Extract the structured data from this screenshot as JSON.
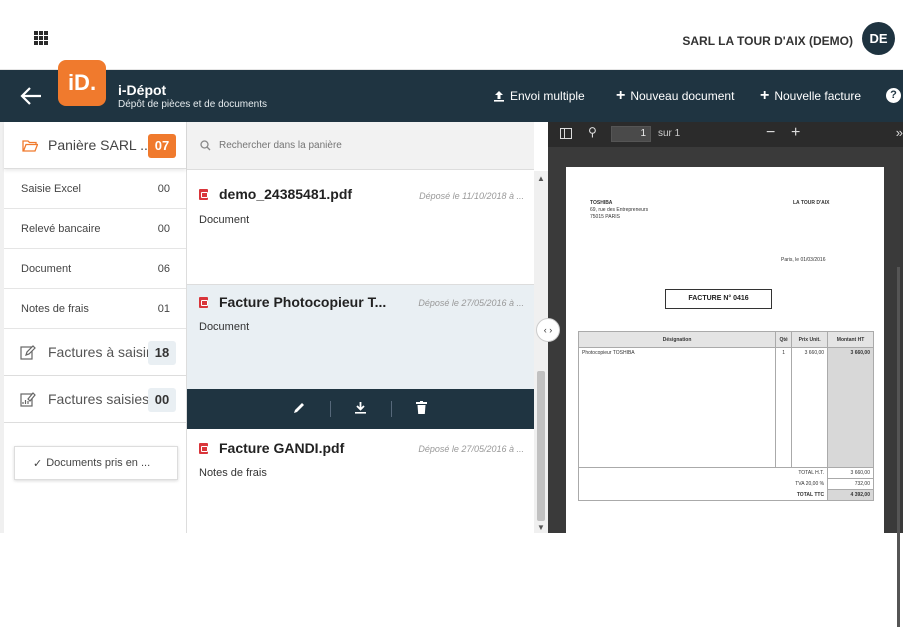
{
  "header": {
    "company": "SARL LA TOUR D'AIX (DEMO)",
    "avatar_initials": "DE"
  },
  "app": {
    "logo_text": "iD.",
    "title": "i-Dépot",
    "subtitle": "Dépôt de pièces et de documents"
  },
  "toolbar": {
    "envoi_multiple": "Envoi multiple",
    "nouveau_document": "Nouveau document",
    "nouvelle_facture": "Nouvelle facture",
    "help": "?"
  },
  "sidebar": {
    "main": {
      "label": "Panière SARL ...",
      "count": "07"
    },
    "items": [
      {
        "label": "Saisie Excel",
        "count": "00"
      },
      {
        "label": "Relevé bancaire",
        "count": "00"
      },
      {
        "label": "Document",
        "count": "06"
      },
      {
        "label": "Notes de frais",
        "count": "01"
      }
    ],
    "groups": [
      {
        "label": "Factures à saisir",
        "count": "18"
      },
      {
        "label": "Factures saisies",
        "count": "00"
      }
    ],
    "docs_button": "Documents pris en ..."
  },
  "search": {
    "placeholder": "Rechercher dans la panière"
  },
  "documents": [
    {
      "title": "demo_24385481.pdf",
      "date": "Déposé le 11/10/2018 à ...",
      "type": "Document"
    },
    {
      "title": "Facture Photocopieur T...",
      "date": "Déposé le 27/05/2016 à ...",
      "type": "Document"
    },
    {
      "title": "Facture GANDI.pdf",
      "date": "Déposé le 27/05/2016 à ...",
      "type": "Notes de frais"
    }
  ],
  "viewer": {
    "page_current": "1",
    "page_of": "sur 1"
  },
  "invoice": {
    "supplier_name": "TOSHIBA",
    "supplier_addr1": "69, rue des Entrepreneurs",
    "supplier_addr2": "75015 PARIS",
    "client": "LA TOUR D'AIX",
    "place_date": "Paris, le 01/03/2016",
    "number": "FACTURE N° 0416",
    "headers": {
      "designation": "Désignation",
      "qty": "Qté",
      "unit_price": "Prix Unit.",
      "amount": "Montant HT"
    },
    "line": {
      "designation": "Photocopieur TOSHIBA",
      "qty": "1",
      "unit_price": "3 660,00",
      "amount": "3 660,00"
    },
    "totals": [
      {
        "label": "TOTAL H.T.",
        "value": "3 660,00"
      },
      {
        "label": "TVA 20,00 %",
        "value": "732,00"
      },
      {
        "label": "TOTAL TTC",
        "value": "4 392,00"
      }
    ]
  },
  "colors": {
    "accent": "#f07a2d",
    "navbar": "#1f3441",
    "pdf_red": "#d9353a"
  }
}
